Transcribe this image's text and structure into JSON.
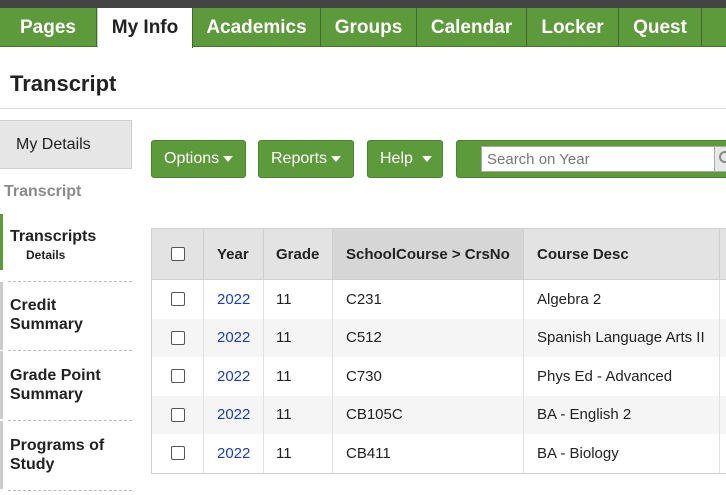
{
  "nav": {
    "tabs": [
      {
        "label": "Pages"
      },
      {
        "label": "My Info",
        "active": true
      },
      {
        "label": "Academics"
      },
      {
        "label": "Groups"
      },
      {
        "label": "Calendar"
      },
      {
        "label": "Locker"
      },
      {
        "label": "Quest"
      }
    ]
  },
  "page": {
    "title": "Transcript"
  },
  "sidebar": {
    "my_details": "My Details",
    "section_heading": "Transcript",
    "items": [
      {
        "label": "Transcripts",
        "sub": "Details",
        "active": true
      },
      {
        "label": "Credit Summary"
      },
      {
        "label": "Grade Point Summary"
      },
      {
        "label": "Programs of Study"
      }
    ]
  },
  "toolbar": {
    "options": "Options",
    "reports": "Reports",
    "help": "Help",
    "search_placeholder": "Search on Year"
  },
  "table": {
    "columns": [
      "Year",
      "Grade",
      "SchoolCourse > CrsNo",
      "Course Desc"
    ],
    "rows": [
      {
        "year": "2022",
        "grade": "11",
        "crsno": "C231",
        "desc": "Algebra 2"
      },
      {
        "year": "2022",
        "grade": "11",
        "crsno": "C512",
        "desc": "Spanish Language Arts II"
      },
      {
        "year": "2022",
        "grade": "11",
        "crsno": "C730",
        "desc": "Phys Ed - Advanced"
      },
      {
        "year": "2022",
        "grade": "11",
        "crsno": "CB105C",
        "desc": "BA - English 2"
      },
      {
        "year": "2022",
        "grade": "11",
        "crsno": "CB411",
        "desc": "BA - Biology"
      }
    ]
  },
  "colors": {
    "accent": "#5d9a3c",
    "link": "#1a3fb5"
  }
}
